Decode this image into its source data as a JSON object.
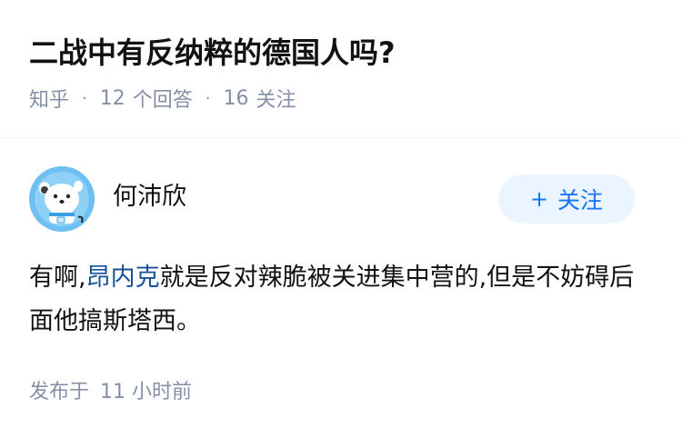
{
  "question": {
    "title": "二战中有反纳粹的德国人吗?",
    "source": "知乎",
    "separator": "·",
    "answer_count": "12",
    "answer_label": "个回答",
    "follow_count": "16",
    "follow_label": "关注"
  },
  "author": {
    "name": "何沛欣",
    "follow_button_icon": "+",
    "follow_button_label": "关注",
    "avatar_icon": "cartoon-bear-avatar"
  },
  "answer": {
    "text_before_link": "有啊,",
    "link_text": "昂内克",
    "text_after_link": "就是反对辣脆被关进集中营的,但是不妨碍后面他搞斯塔西。"
  },
  "timestamp": {
    "label": "发布于",
    "value": "11 小时前"
  },
  "colors": {
    "meta": "#8590a6",
    "link": "#175199",
    "accent": "#1772f6",
    "button_bg": "#ebf5ff"
  }
}
